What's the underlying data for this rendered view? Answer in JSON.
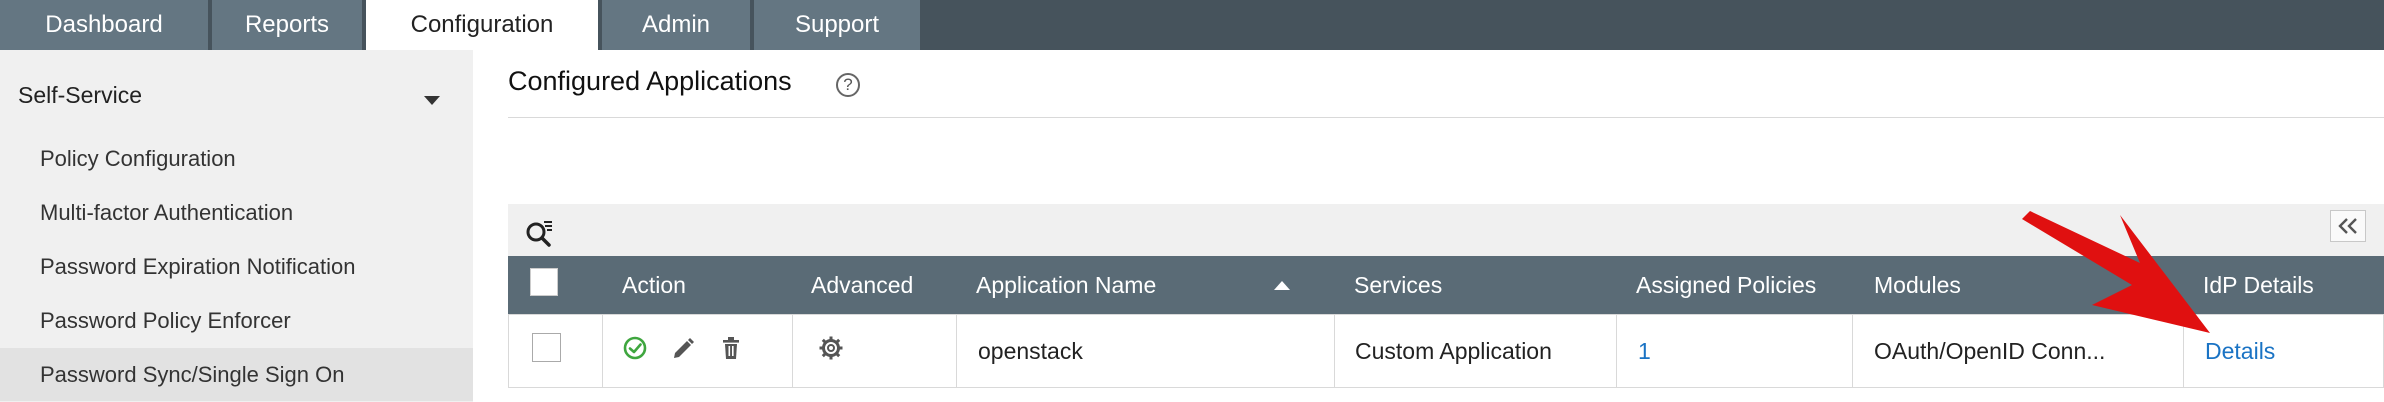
{
  "topnav": {
    "tabs": [
      {
        "label": "Dashboard",
        "active": false
      },
      {
        "label": "Reports",
        "active": false
      },
      {
        "label": "Configuration",
        "active": true
      },
      {
        "label": "Admin",
        "active": false
      },
      {
        "label": "Support",
        "active": false
      }
    ]
  },
  "sidebar": {
    "section_title": "Self-Service",
    "items": [
      {
        "label": "Policy Configuration"
      },
      {
        "label": "Multi-factor Authentication"
      },
      {
        "label": "Password Expiration Notification"
      },
      {
        "label": "Password Policy Enforcer"
      },
      {
        "label": "Password Sync/Single Sign On",
        "active": true
      }
    ]
  },
  "main": {
    "title": "Configured Applications",
    "help_glyph": "?",
    "table": {
      "columns": [
        "Action",
        "Advanced",
        "Application Name",
        "Services",
        "Assigned Policies",
        "Modules",
        "IdP Details"
      ],
      "sorted_column": "Application Name",
      "rows": [
        {
          "application_name": "openstack",
          "services": "Custom Application",
          "assigned_policies": "1",
          "modules": "OAuth/OpenID Conn...",
          "idp_details": "Details",
          "enabled": true
        }
      ]
    }
  },
  "colors": {
    "topnav_bg": "#46535c",
    "tab_bg": "#647682",
    "table_header_bg": "#5a6b76",
    "link": "#1a73c4",
    "enabled_green": "#3fa63f",
    "annotation_arrow": "#e01010"
  },
  "icons": {
    "help": "question-circle-icon",
    "search": "search-filter-icon",
    "collapse": "double-chevron-left-icon",
    "enable": "check-circle-icon",
    "edit": "pencil-icon",
    "delete": "trash-icon",
    "advanced": "gear-icon",
    "sort": "sort-ascending-icon"
  }
}
